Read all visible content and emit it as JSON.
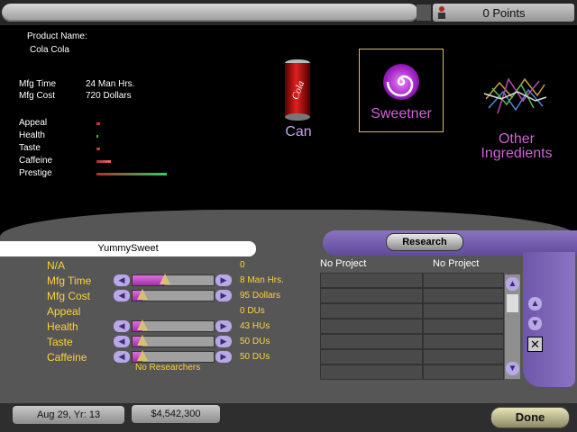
{
  "top": {
    "points": "0 Points"
  },
  "product": {
    "name_label": "Product Name:",
    "name": "Cola Cola",
    "mfg_time_label": "Mfg Time",
    "mfg_time": "24 Man Hrs.",
    "mfg_cost_label": "Mfg Cost",
    "mfg_cost": "720 Dollars",
    "stats": [
      {
        "label": "Appeal",
        "level": 0.05
      },
      {
        "label": "Health",
        "level": 0.02
      },
      {
        "label": "Taste",
        "level": 0.05
      },
      {
        "label": "Caffeine",
        "level": 0.2
      },
      {
        "label": "Prestige",
        "level": 1.0
      }
    ]
  },
  "ingredients": {
    "can": "Can",
    "sweetener": "Sweetner",
    "other": "Other Ingredients"
  },
  "selected_ingredient": "YummySweet",
  "sliders": {
    "na_label": "N/A",
    "na_value": "0",
    "rows": [
      {
        "label": "Mfg Time",
        "value": "8 Man Hrs.",
        "level": 0.4,
        "has_control": true
      },
      {
        "label": "Mfg Cost",
        "value": "95 Dollars",
        "level": 0.12,
        "has_control": true
      },
      {
        "label": "Appeal",
        "value": "0 DUs",
        "level": 0,
        "has_control": false
      },
      {
        "label": "Health",
        "value": "43 HUs",
        "level": 0.12,
        "has_control": true
      },
      {
        "label": "Taste",
        "value": "50 DUs",
        "level": 0.12,
        "has_control": true
      },
      {
        "label": "Caffeine",
        "value": "50 DUs",
        "level": 0.12,
        "has_control": true
      }
    ],
    "researchers": "No Researchers"
  },
  "research": {
    "button": "Research",
    "col1": "No Project",
    "col2": "No Project"
  },
  "bottom": {
    "date": "Aug 29, Yr: 13",
    "money": "$4,542,300",
    "done": "Done"
  },
  "colors": {
    "label_yellow": "#ffd23a",
    "sweetener_purple": "#c040e0",
    "slider_fill": "#c050c8",
    "panel_gray": "#565656"
  }
}
